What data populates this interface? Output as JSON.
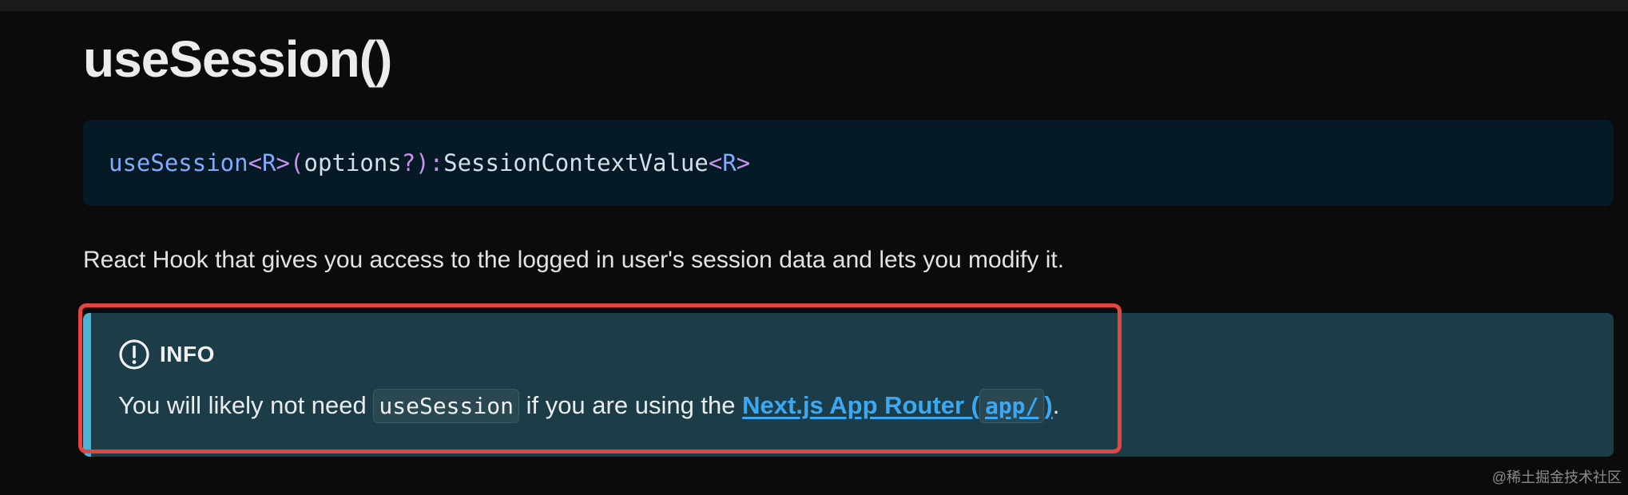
{
  "page": {
    "title": "useSession()",
    "signature": {
      "fn": "useSession",
      "lt": "<",
      "generic": "R",
      "gt": ">",
      "lparen": "(",
      "param": "options",
      "optional": "?",
      "rparen": ")",
      "colon": ":",
      "return_type": "SessionContextValue",
      "ret_lt": "<",
      "ret_generic": "R",
      "ret_gt": ">"
    },
    "description": "React Hook that gives you access to the logged in user's session data and lets you modify it."
  },
  "admonition": {
    "icon": "exclamation-circle-icon",
    "title": "INFO",
    "text_before": "You will likely not need ",
    "code": "useSession",
    "text_middle": " if you are using the ",
    "link_text": "Next.js App Router (",
    "link_code": "app/",
    "link_close": ")",
    "text_end": "."
  },
  "watermark": "@稀土掘金技术社区",
  "colors": {
    "background": "#0b0b0c",
    "code_background": "#051a24",
    "admonition_background": "#1c3d48",
    "admonition_accent": "#4cb3d4",
    "link": "#3ba8f3",
    "highlight": "#e5453e"
  }
}
